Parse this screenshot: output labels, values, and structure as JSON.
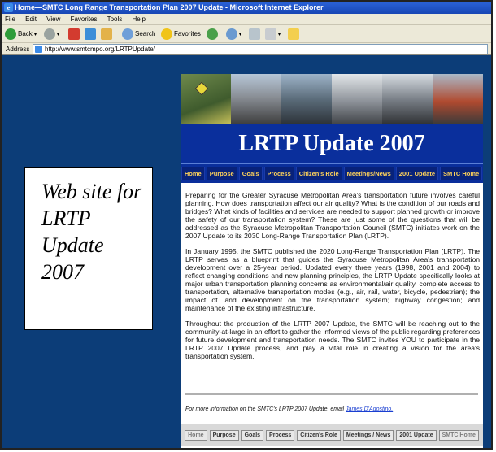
{
  "window": {
    "title": "Home—SMTC Long Range Transportation Plan 2007 Update - Microsoft Internet Explorer"
  },
  "menu": [
    "File",
    "Edit",
    "View",
    "Favorites",
    "Tools",
    "Help"
  ],
  "toolbar": {
    "back": "Back",
    "search": "Search",
    "favorites": "Favorites"
  },
  "address": {
    "label": "Address",
    "url": "http://www.smtcmpo.org/LRTPUpdate/"
  },
  "callout": {
    "text": "Web site for LRTP Update 2007"
  },
  "page": {
    "banner": "LRTP Update 2007",
    "nav": [
      "Home",
      "Purpose",
      "Goals",
      "Process",
      "Citizen's Role",
      "Meetings/News",
      "2001 Update",
      "SMTC Home"
    ],
    "paragraphs": [
      "Preparing for the Greater Syracuse Metropolitan Area's transportation future involves careful planning. How does transportation affect our air quality? What is the condition of our roads and bridges? What kinds of facilities and services are needed to support planned growth or improve the safety of our transportation system? These are just some of the questions that will be addressed as the Syracuse Metropolitan Transportation Council (SMTC) initiates work on the 2007 Update to its 2030 Long-Range Transportation Plan (LRTP).",
      "In January 1995, the SMTC published the 2020 Long-Range Transportation Plan (LRTP). The LRTP serves as a blueprint that guides the Syracuse Metropolitan Area's transportation development over a 25-year period. Updated every three years (1998, 2001 and 2004) to reflect changing conditions and new planning principles, the LRTP Update specifically looks at major urban transportation planning concerns as environmental/air quality, complete access to transportation, alternative transportation modes (e.g., air, rail, water, bicycle, pedestrian); the impact of land development on the transportation system; highway congestion; and maintenance of the existing infrastructure.",
      "Throughout the production of the LRTP 2007 Update, the SMTC will be reaching out to the community-at-large in an effort to gather the informed views of the public regarding preferences for future development and transportation needs. The SMTC invites YOU to participate in the LRTP 2007 Update process, and play a vital role in creating a vision for the area's transportation system."
    ],
    "footer_note": "For more information on the SMTC's LRTP 2007 Update, email",
    "footer_link": "James D'Agostino.",
    "footer_nav": [
      "Home",
      "Purpose",
      "Goals",
      "Process",
      "Citizen's Role",
      "Meetings / News",
      "2001 Update",
      "SMTC Home"
    ]
  }
}
